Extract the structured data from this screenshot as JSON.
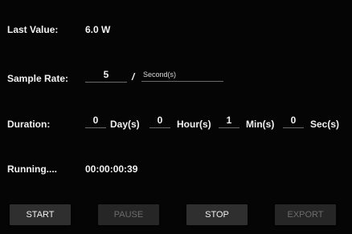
{
  "last_value": {
    "label": "Last Value:",
    "value": "6.0 W"
  },
  "sample_rate": {
    "label": "Sample Rate:",
    "value": "5",
    "separator": "/",
    "unit": "Second(s)"
  },
  "duration": {
    "label": "Duration:",
    "fields": [
      {
        "value": "0",
        "unit": "Day(s)"
      },
      {
        "value": "0",
        "unit": "Hour(s)"
      },
      {
        "value": "1",
        "unit": "Min(s)"
      },
      {
        "value": "0",
        "unit": "Sec(s)"
      }
    ]
  },
  "running": {
    "label": "Running....",
    "elapsed": "00:00:00:39"
  },
  "buttons": {
    "start": "START",
    "pause": "PAUSE",
    "stop": "STOP",
    "export": "EXPORT"
  },
  "colors": {
    "background": "#000000",
    "button_bg": "#2f2f2f",
    "disabled_text": "#6c6c6c"
  }
}
